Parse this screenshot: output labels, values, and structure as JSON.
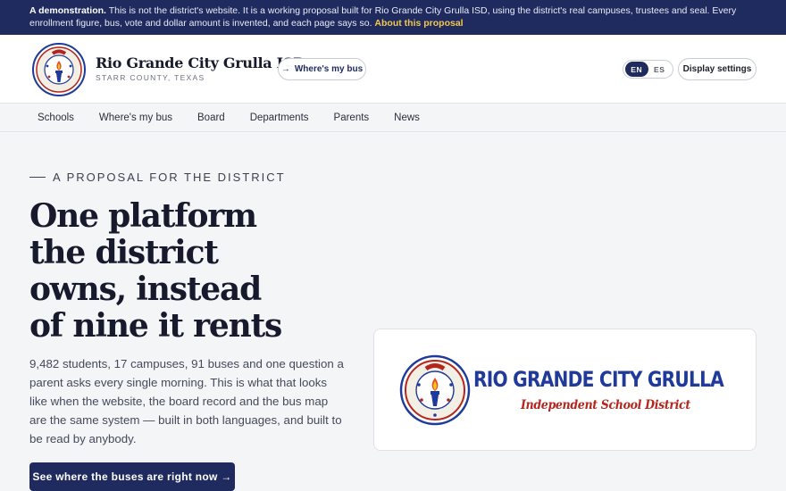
{
  "banner": {
    "lead": "A demonstration.",
    "text": "This is not the district's website. It is a working proposal built for Rio Grande City Grulla ISD, using the district's real campuses, trustees and seal. Every enrollment figure, bus, vote and dollar amount is invented, and each page says so.",
    "link": "About this proposal"
  },
  "header": {
    "title": "Rio Grande City Grulla ISD",
    "subtitle": "STARR COUNTY, TEXAS",
    "bus_button": "Where's my bus",
    "lang_en": "EN",
    "lang_es": "ES",
    "settings_button": "Display settings",
    "seal_text": "RGCGISD",
    "seal_ring": [
      "PARENTS",
      "COMMUNITY",
      "STUDENTS",
      "EDUCATORS"
    ]
  },
  "nav": {
    "items": [
      "Schools",
      "Where's my bus",
      "Board",
      "Departments",
      "Parents",
      "News"
    ]
  },
  "hero": {
    "eyebrow": "A PROPOSAL FOR THE DISTRICT",
    "headline": [
      "One platform",
      "the district",
      "owns, instead",
      "of nine it rents"
    ],
    "lede": "9,482 students, 17 campuses, 91 buses and one question a parent asks every single morning. This is what that looks like when the website, the board record and the bus map are the same system — built in both languages, and built to be read by anybody.",
    "cta": "See where the buses are right now →"
  },
  "logo_card": {
    "title": "RIO GRANDE CITY GRULLA",
    "subtitle": "Independent School District"
  },
  "colors": {
    "navy": "#1f2a5e",
    "logo_blue": "#1f3a9a",
    "logo_red": "#b3261e",
    "link_gold": "#f2c94c"
  }
}
